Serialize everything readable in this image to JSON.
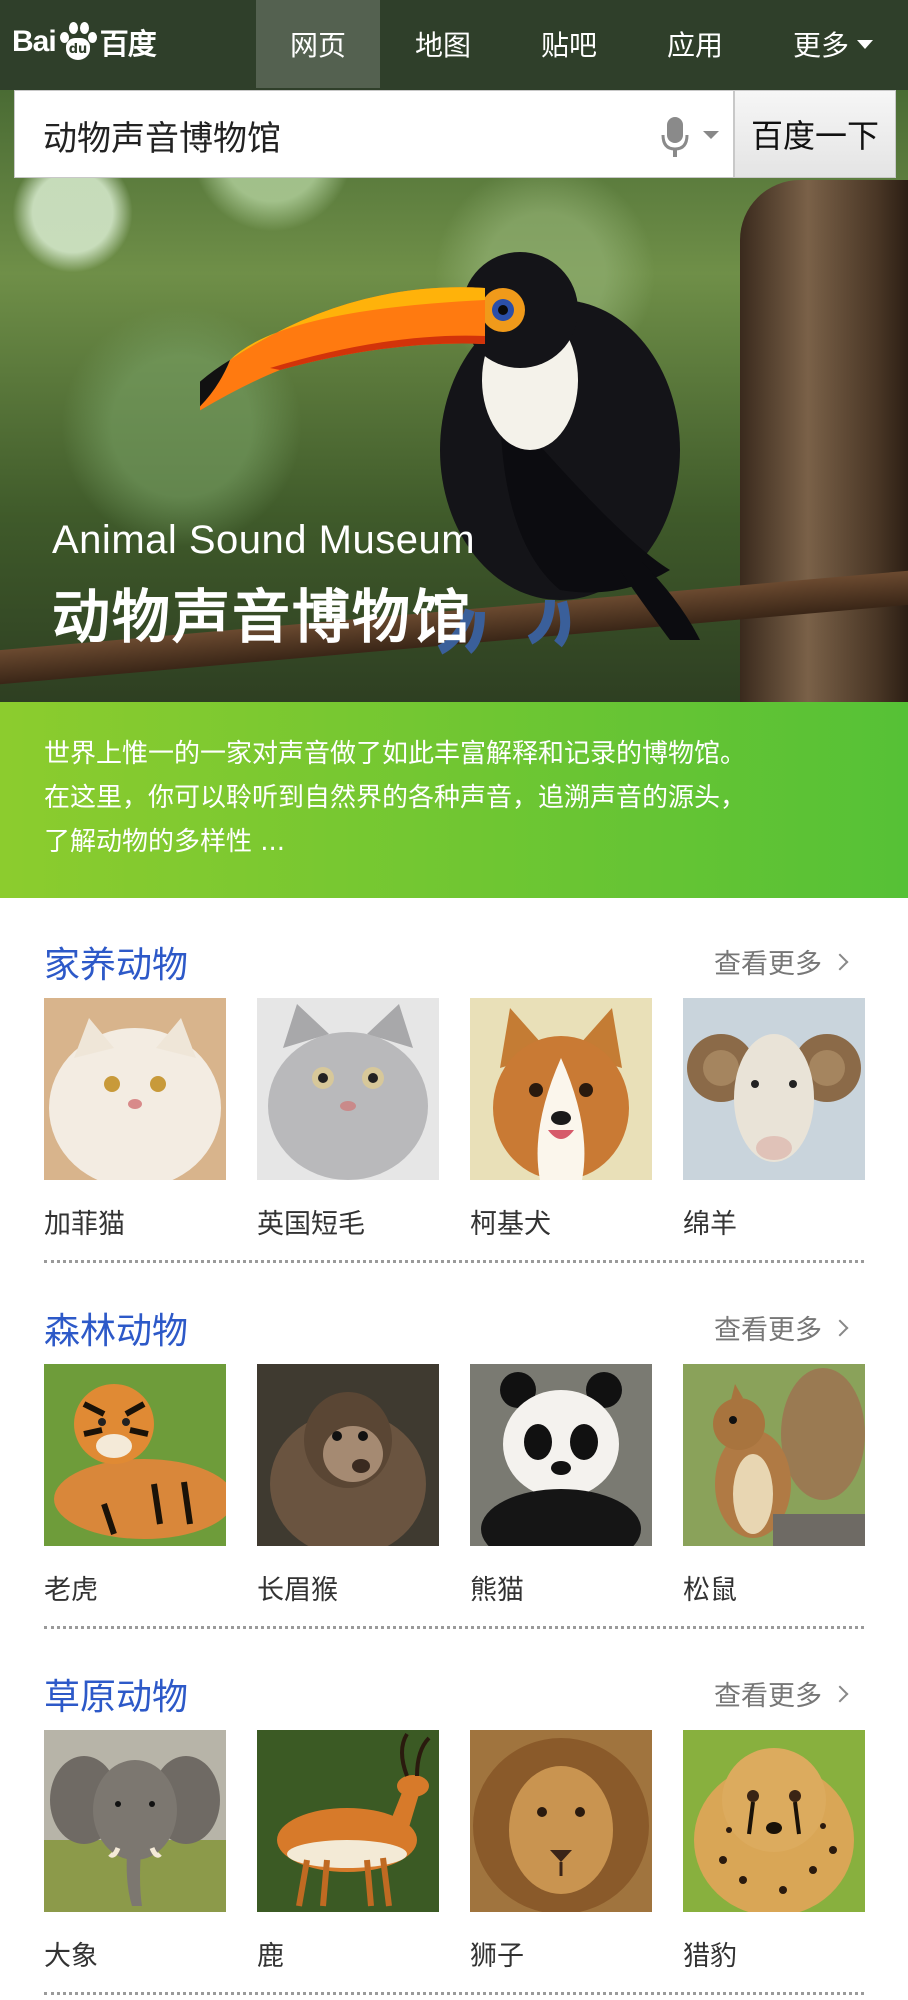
{
  "header": {
    "logo": {
      "latin": "Bai",
      "paw_text": "du",
      "cn": "百度"
    },
    "nav": [
      {
        "label": "网页",
        "active": true
      },
      {
        "label": "地图",
        "active": false
      },
      {
        "label": "贴吧",
        "active": false
      },
      {
        "label": "应用",
        "active": false
      },
      {
        "label": "更多",
        "active": false
      }
    ]
  },
  "search": {
    "query": "动物声音博物馆",
    "button_label": "百度一下",
    "icons": [
      "microphone-icon",
      "caret-down-icon"
    ]
  },
  "hero": {
    "title_en": "Animal Sound Museum",
    "title_cn": "动物声音博物馆",
    "image_subject": "toucan-on-branch"
  },
  "intro": {
    "lines": [
      "世界上惟一的一家对声音做了如此丰富解释和记录的博物馆。",
      "在这里，你可以聆听到自然界的各种声音，追溯声音的源头，",
      "了解动物的多样性 ..."
    ]
  },
  "categories": [
    {
      "title": "家养动物",
      "more_label": "查看更多",
      "items": [
        {
          "label": "加菲猫",
          "icon": "persian-cat"
        },
        {
          "label": "英国短毛",
          "icon": "british-shorthair-cat"
        },
        {
          "label": "柯基犬",
          "icon": "corgi-dog"
        },
        {
          "label": "绵羊",
          "icon": "ram-sheep"
        }
      ]
    },
    {
      "title": "森林动物",
      "more_label": "查看更多",
      "items": [
        {
          "label": "老虎",
          "icon": "tiger"
        },
        {
          "label": "长眉猴",
          "icon": "monkey"
        },
        {
          "label": "熊猫",
          "icon": "panda"
        },
        {
          "label": "松鼠",
          "icon": "squirrel"
        }
      ]
    },
    {
      "title": "草原动物",
      "more_label": "查看更多",
      "items": [
        {
          "label": "大象",
          "icon": "elephant"
        },
        {
          "label": "鹿",
          "icon": "impala"
        },
        {
          "label": "狮子",
          "icon": "lion"
        },
        {
          "label": "猎豹",
          "icon": "cheetah"
        }
      ]
    }
  ],
  "colors": {
    "header_bg": "#2f3f2a",
    "category_title": "#2d59c8",
    "intro_gradient_start": "#8ccc2e",
    "intro_gradient_end": "#56c136"
  }
}
